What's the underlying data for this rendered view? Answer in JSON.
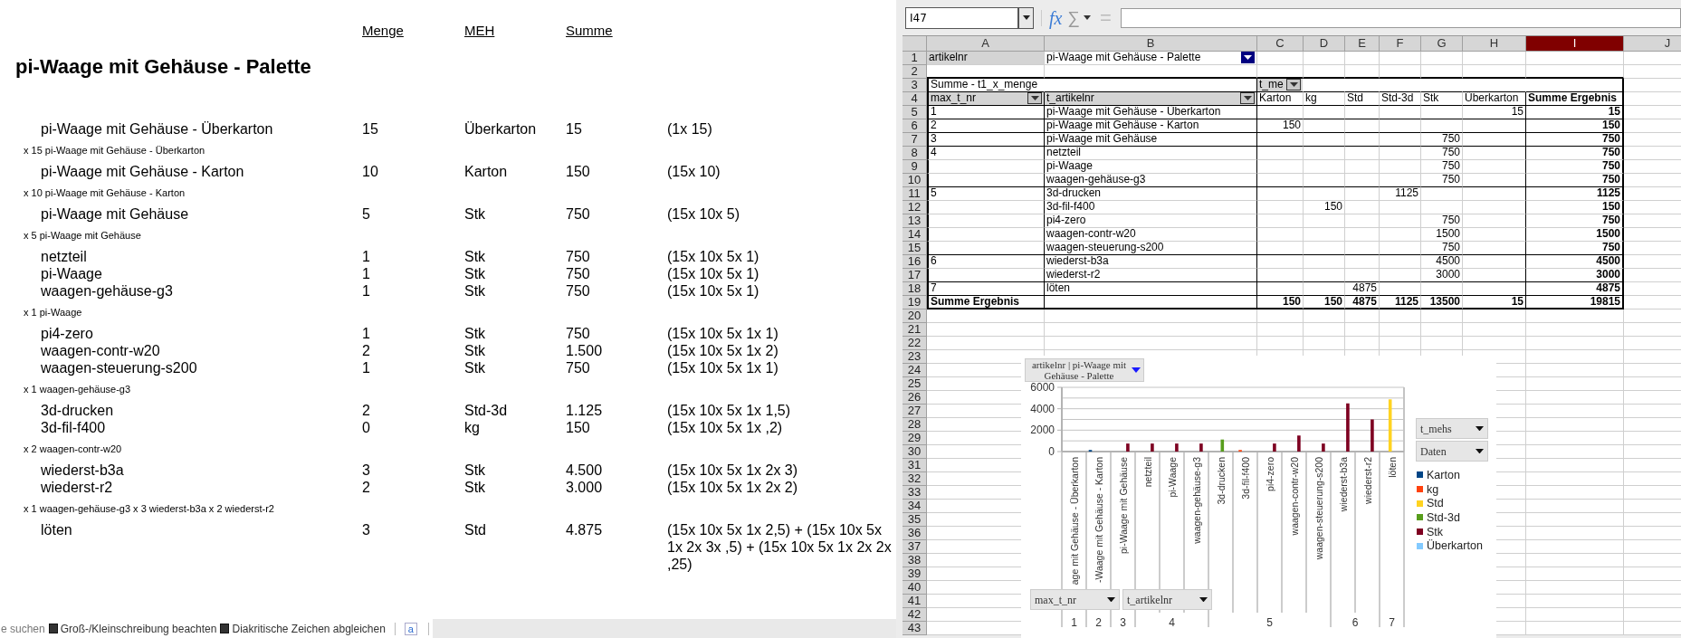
{
  "document": {
    "columns": [
      "Menge",
      "MEH",
      "Summe"
    ],
    "title": "pi-Waage mit Gehäuse - Palette",
    "sections": [
      {
        "items": [
          {
            "name": "pi-Waage mit Gehäuse - Überkarton",
            "quantity": "15",
            "unit": "Überkarton",
            "total": "15",
            "formula": "(1x 15)"
          }
        ],
        "note": "x 15 pi-Waage mit Gehäuse - Überkarton"
      },
      {
        "items": [
          {
            "name": "pi-Waage mit Gehäuse - Karton",
            "quantity": "10",
            "unit": "Karton",
            "total": "150",
            "formula": "(15x 10)"
          }
        ],
        "note": "x 10 pi-Waage mit Gehäuse - Karton"
      },
      {
        "items": [
          {
            "name": "pi-Waage mit Gehäuse",
            "quantity": "5",
            "unit": "Stk",
            "total": "750",
            "formula": "(15x 10x 5)"
          }
        ],
        "note": "x 5 pi-Waage mit Gehäuse"
      },
      {
        "items": [
          {
            "name": "netzteil",
            "quantity": "1",
            "unit": "Stk",
            "total": "750",
            "formula": "(15x 10x 5x 1)"
          },
          {
            "name": "pi-Waage",
            "quantity": "1",
            "unit": "Stk",
            "total": "750",
            "formula": "(15x 10x 5x 1)"
          },
          {
            "name": "waagen-gehäuse-g3",
            "quantity": "1",
            "unit": "Stk",
            "total": "750",
            "formula": "(15x 10x 5x 1)"
          }
        ],
        "note": "x 1 pi-Waage"
      },
      {
        "items": [
          {
            "name": "pi4-zero",
            "quantity": "1",
            "unit": "Stk",
            "total": "750",
            "formula": "(15x 10x 5x 1x 1)"
          },
          {
            "name": "waagen-contr-w20",
            "quantity": "2",
            "unit": "Stk",
            "total": "1.500",
            "formula": "(15x 10x 5x 1x 2)"
          },
          {
            "name": "waagen-steuerung-s200",
            "quantity": "1",
            "unit": "Stk",
            "total": "750",
            "formula": "(15x 10x 5x 1x 1)"
          }
        ],
        "note": "x 1 waagen-gehäuse-g3"
      },
      {
        "items": [
          {
            "name": "3d-drucken",
            "quantity": "2",
            "unit": "Std-3d",
            "total": "1.125",
            "formula": "(15x 10x 5x 1x 1,5)"
          },
          {
            "name": "3d-fil-f400",
            "quantity": "0",
            "unit": "kg",
            "total": "150",
            "formula": "(15x 10x 5x 1x ,2)"
          }
        ],
        "note": "x 2 waagen-contr-w20"
      },
      {
        "items": [
          {
            "name": "wiederst-b3a",
            "quantity": "3",
            "unit": "Stk",
            "total": "4.500",
            "formula": "(15x 10x 5x 1x 2x 3)"
          },
          {
            "name": "wiederst-r2",
            "quantity": "2",
            "unit": "Stk",
            "total": "3.000",
            "formula": "(15x 10x 5x 1x 2x 2)"
          }
        ],
        "note": "x 1 waagen-gehäuse-g3 x 3 wiederst-b3a x 2 wiederst-r2"
      },
      {
        "items": [
          {
            "name": "löten",
            "quantity": "3",
            "unit": "Std",
            "total": "4.875",
            "formula": "(15x 10x 5x 1x 2,5) + (15x 10x 5x 1x 2x 3x ,5) + (15x 10x 5x 1x 2x 2x ,25)"
          }
        ]
      }
    ]
  },
  "find_bar": {
    "label": "e suchen",
    "options": [
      {
        "label": "Groß-/Kleinschreibung beachten",
        "checked": false
      },
      {
        "label": "Diakritische Zeichen abgleichen",
        "checked": false
      }
    ],
    "icon_label": "a"
  },
  "spreadsheet": {
    "name_box": "I47",
    "function_icon": "fx",
    "sum_icon": "∑",
    "equals_icon": "=",
    "columns": [
      {
        "label": "A",
        "selected": false
      },
      {
        "label": "B",
        "selected": false
      },
      {
        "label": "C",
        "selected": false
      },
      {
        "label": "D",
        "selected": false
      },
      {
        "label": "E",
        "selected": false
      },
      {
        "label": "F",
        "selected": false
      },
      {
        "label": "G",
        "selected": false
      },
      {
        "label": "H",
        "selected": false
      },
      {
        "label": "I",
        "selected": true
      },
      {
        "label": "J",
        "selected": false
      }
    ],
    "row_numbers": [
      "1",
      "2",
      "3",
      "4",
      "5",
      "6",
      "7",
      "8",
      "9",
      "10",
      "11",
      "12",
      "13",
      "14",
      "15",
      "16",
      "17",
      "18",
      "19",
      "20",
      "21",
      "22",
      "23",
      "24",
      "25",
      "26",
      "27",
      "28",
      "29",
      "30",
      "31",
      "32",
      "33",
      "34",
      "35",
      "36",
      "37",
      "38",
      "39",
      "40",
      "41",
      "42",
      "43"
    ],
    "page_filter": {
      "field": "artikelnr",
      "value": "pi-Waage mit Gehäuse - Palette"
    },
    "pivot": {
      "title": "Summe - t1_x_menge",
      "column_field": "t_me",
      "row_fields": [
        "max_t_nr",
        "t_artikelnr"
      ],
      "data_columns": [
        "Karton",
        "kg",
        "Std",
        "Std-3d",
        "Stk",
        "Überkarton",
        "Summe Ergebnis"
      ],
      "rows": [
        {
          "max_t_nr": "1",
          "t_artikelnr": "pi-Waage mit Gehäuse - Überkarton",
          "values": {
            "ueberkarton": "15",
            "summe_ergebnis": "15"
          }
        },
        {
          "max_t_nr": "2",
          "t_artikelnr": "pi-Waage mit Gehäuse - Karton",
          "values": {
            "karton": "150",
            "summe_ergebnis": "150"
          }
        },
        {
          "max_t_nr": "3",
          "t_artikelnr": "pi-Waage mit Gehäuse",
          "values": {
            "stk": "750",
            "summe_ergebnis": "750"
          }
        },
        {
          "max_t_nr": "4",
          "t_artikelnr": "netzteil",
          "values": {
            "stk": "750",
            "summe_ergebnis": "750"
          }
        },
        {
          "t_artikelnr": "pi-Waage",
          "values": {
            "stk": "750",
            "summe_ergebnis": "750"
          }
        },
        {
          "t_artikelnr": "waagen-gehäuse-g3",
          "values": {
            "stk": "750",
            "summe_ergebnis": "750"
          }
        },
        {
          "max_t_nr": "5",
          "t_artikelnr": "3d-drucken",
          "values": {
            "std_3d": "1125",
            "summe_ergebnis": "1125"
          }
        },
        {
          "t_artikelnr": "3d-fil-f400",
          "values": {
            "kg": "150",
            "summe_ergebnis": "150"
          }
        },
        {
          "t_artikelnr": "pi4-zero",
          "values": {
            "stk": "750",
            "summe_ergebnis": "750"
          }
        },
        {
          "t_artikelnr": "waagen-contr-w20",
          "values": {
            "stk": "1500",
            "summe_ergebnis": "1500"
          }
        },
        {
          "t_artikelnr": "waagen-steuerung-s200",
          "values": {
            "stk": "750",
            "summe_ergebnis": "750"
          }
        },
        {
          "max_t_nr": "6",
          "t_artikelnr": "wiederst-b3a",
          "values": {
            "stk": "4500",
            "summe_ergebnis": "4500"
          }
        },
        {
          "t_artikelnr": "wiederst-r2",
          "values": {
            "stk": "3000",
            "summe_ergebnis": "3000"
          }
        },
        {
          "max_t_nr": "7",
          "t_artikelnr": "löten",
          "values": {
            "std": "4875",
            "summe_ergebnis": "4875"
          }
        }
      ],
      "total": {
        "label": "Summe Ergebnis",
        "values": {
          "karton": "150",
          "kg": "150",
          "std": "4875",
          "std_3d": "1125",
          "stk": "13500",
          "ueberkarton": "15",
          "summe_ergebnis": "19815"
        }
      }
    },
    "chart": {
      "filter_button": "artikelnr | pi-Waage mit Gehäuse - Palette",
      "row_field_buttons": [
        "max_t_nr",
        "t_artikelnr"
      ],
      "column_field_buttons": [
        "t_mehs",
        "Daten"
      ],
      "group_labels": [
        "1",
        "2",
        "3",
        "4",
        "5",
        "6",
        "7"
      ],
      "chart_data": {
        "type": "bar",
        "categories": [
          "age mit Gehäuse - Überkarton",
          "-Waage mit Gehäuse - Karton",
          "pi-Waage mit Gehäuse",
          "netzteil",
          "pi-Waage",
          "waagen-gehäuse-g3",
          "3d-drucken",
          "3d-fil-f400",
          "pi4-zero",
          "waagen-contr-w20",
          "waagen-steuerung-s200",
          "wiederst-b3a",
          "wiederst-r2",
          "löten"
        ],
        "ylim": [
          0,
          6000
        ],
        "yticks": [
          0,
          2000,
          4000,
          6000
        ],
        "legend": "right",
        "series": [
          {
            "name": "Karton",
            "color": "#004586",
            "values": [
              null,
              150,
              null,
              null,
              null,
              null,
              null,
              null,
              null,
              null,
              null,
              null,
              null,
              null
            ]
          },
          {
            "name": "kg",
            "color": "#ff420e",
            "values": [
              null,
              null,
              null,
              null,
              null,
              null,
              null,
              150,
              null,
              null,
              null,
              null,
              null,
              null
            ]
          },
          {
            "name": "Std",
            "color": "#ffd320",
            "values": [
              null,
              null,
              null,
              null,
              null,
              null,
              null,
              null,
              null,
              null,
              null,
              null,
              null,
              4875
            ]
          },
          {
            "name": "Std-3d",
            "color": "#579d1c",
            "values": [
              null,
              null,
              null,
              null,
              null,
              null,
              1125,
              null,
              null,
              null,
              null,
              null,
              null,
              null
            ]
          },
          {
            "name": "Stk",
            "color": "#7e0021",
            "values": [
              null,
              null,
              750,
              750,
              750,
              750,
              null,
              null,
              750,
              1500,
              750,
              4500,
              3000,
              null
            ]
          },
          {
            "name": "Überkarton",
            "color": "#83caff",
            "values": [
              null,
              null,
              null,
              null,
              null,
              null,
              null,
              null,
              null,
              null,
              null,
              null,
              null,
              null
            ]
          }
        ]
      }
    }
  }
}
